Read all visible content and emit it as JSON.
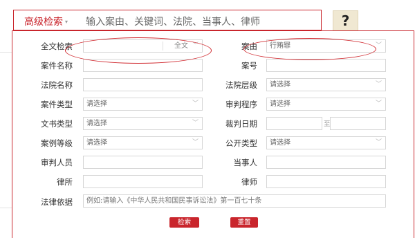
{
  "topbar": {
    "advanced_label": "高级检索",
    "advanced_caret": "▾",
    "query_placeholder": "输入案由、关键词、法院、当事人、律师",
    "help_glyph": "?"
  },
  "form": {
    "full_text": {
      "label": "全文检索",
      "value": "",
      "scope": "全文"
    },
    "cause": {
      "label": "案由",
      "value": "行贿罪"
    },
    "case_name": {
      "label": "案件名称",
      "value": ""
    },
    "case_no": {
      "label": "案号",
      "value": ""
    },
    "court_name": {
      "label": "法院名称",
      "value": ""
    },
    "court_level": {
      "label": "法院层级",
      "value": "请选择"
    },
    "case_type": {
      "label": "案件类型",
      "value": "请选择"
    },
    "trial_procedure": {
      "label": "审判程序",
      "value": "请选择"
    },
    "doc_type": {
      "label": "文书类型",
      "value": "请选择"
    },
    "judgment_date": {
      "label": "裁判日期",
      "from": "",
      "sep": "至",
      "to": ""
    },
    "case_grade": {
      "label": "案例等级",
      "value": "请选择"
    },
    "disclosure_type": {
      "label": "公开类型",
      "value": "请选择"
    },
    "judge": {
      "label": "审判人员",
      "value": ""
    },
    "party": {
      "label": "当事人",
      "value": ""
    },
    "law_firm": {
      "label": "律所",
      "value": ""
    },
    "lawyer": {
      "label": "律师",
      "value": ""
    },
    "legal_basis": {
      "label": "法律依据",
      "placeholder": "例如:请输入《中华人民共和国民事诉讼法》第一百七十条"
    },
    "search_label": "检索",
    "reset_label": "重置"
  },
  "icons": {
    "chevron": "chevron-down-icon",
    "help": "help-icon"
  },
  "colors": {
    "accent": "#c9252c",
    "help_bg": "#f0e8d2"
  }
}
